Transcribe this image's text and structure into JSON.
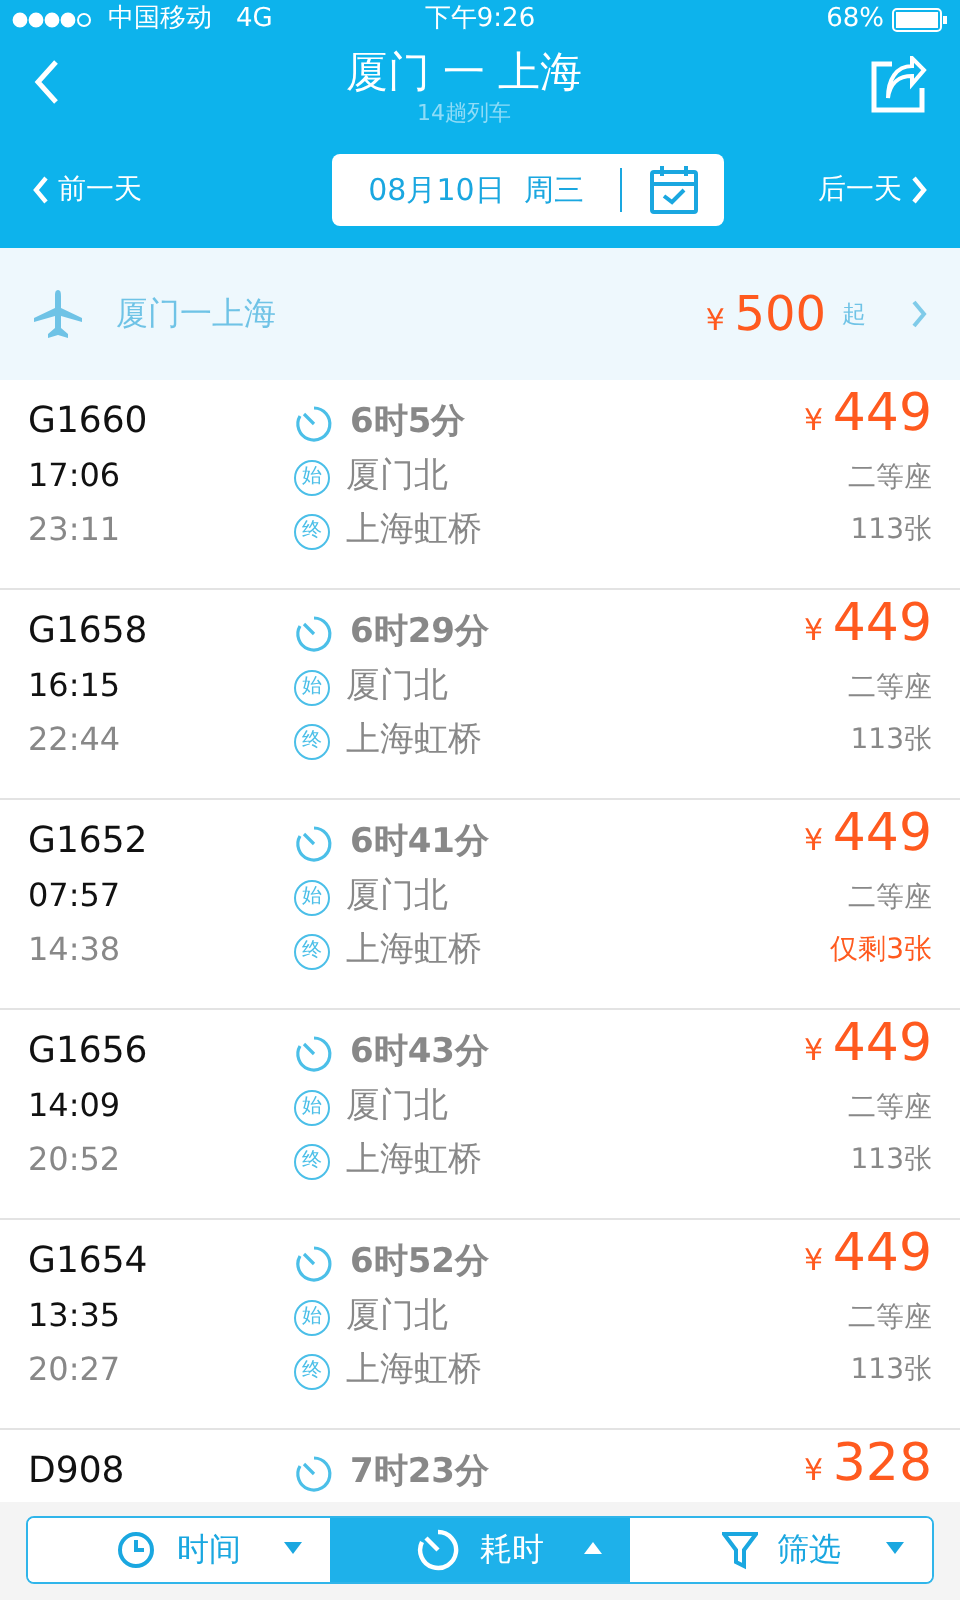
{
  "status_bar": {
    "carrier": "中国移动",
    "network": "4G",
    "time": "下午9:26",
    "battery": "68%"
  },
  "header": {
    "title": "厦门 一 上海",
    "subtitle": "14趟列车",
    "prev_day": "前一天",
    "next_day": "后一天",
    "date": "08月10日  周三"
  },
  "flight_banner": {
    "route": "厦门一上海",
    "currency": "¥",
    "price": "500",
    "suffix": "起"
  },
  "trains": [
    {
      "number": "G1660",
      "depart": "17:06",
      "arrive": "23:11",
      "duration": "6时5分",
      "from_mark": "始",
      "from": "厦门北",
      "to_mark": "终",
      "to": "上海虹桥",
      "currency": "¥",
      "price": "449",
      "seat": "二等座",
      "tickets": "113张",
      "low_stock": false
    },
    {
      "number": "G1658",
      "depart": "16:15",
      "arrive": "22:44",
      "duration": "6时29分",
      "from_mark": "始",
      "from": "厦门北",
      "to_mark": "终",
      "to": "上海虹桥",
      "currency": "¥",
      "price": "449",
      "seat": "二等座",
      "tickets": "113张",
      "low_stock": false
    },
    {
      "number": "G1652",
      "depart": "07:57",
      "arrive": "14:38",
      "duration": "6时41分",
      "from_mark": "始",
      "from": "厦门北",
      "to_mark": "终",
      "to": "上海虹桥",
      "currency": "¥",
      "price": "449",
      "seat": "二等座",
      "tickets": "仅剩3张",
      "low_stock": true
    },
    {
      "number": "G1656",
      "depart": "14:09",
      "arrive": "20:52",
      "duration": "6时43分",
      "from_mark": "始",
      "from": "厦门北",
      "to_mark": "终",
      "to": "上海虹桥",
      "currency": "¥",
      "price": "449",
      "seat": "二等座",
      "tickets": "113张",
      "low_stock": false
    },
    {
      "number": "G1654",
      "depart": "13:35",
      "arrive": "20:27",
      "duration": "6时52分",
      "from_mark": "始",
      "from": "厦门北",
      "to_mark": "终",
      "to": "上海虹桥",
      "currency": "¥",
      "price": "449",
      "seat": "二等座",
      "tickets": "113张",
      "low_stock": false
    },
    {
      "number": "D908",
      "duration": "7时23分",
      "currency": "¥",
      "price": "328"
    }
  ],
  "sort_bar": [
    {
      "kind": "time",
      "label": "时间",
      "selected": false
    },
    {
      "kind": "duration",
      "label": "耗时",
      "selected": true
    },
    {
      "kind": "filter",
      "label": "筛选",
      "selected": false
    }
  ]
}
